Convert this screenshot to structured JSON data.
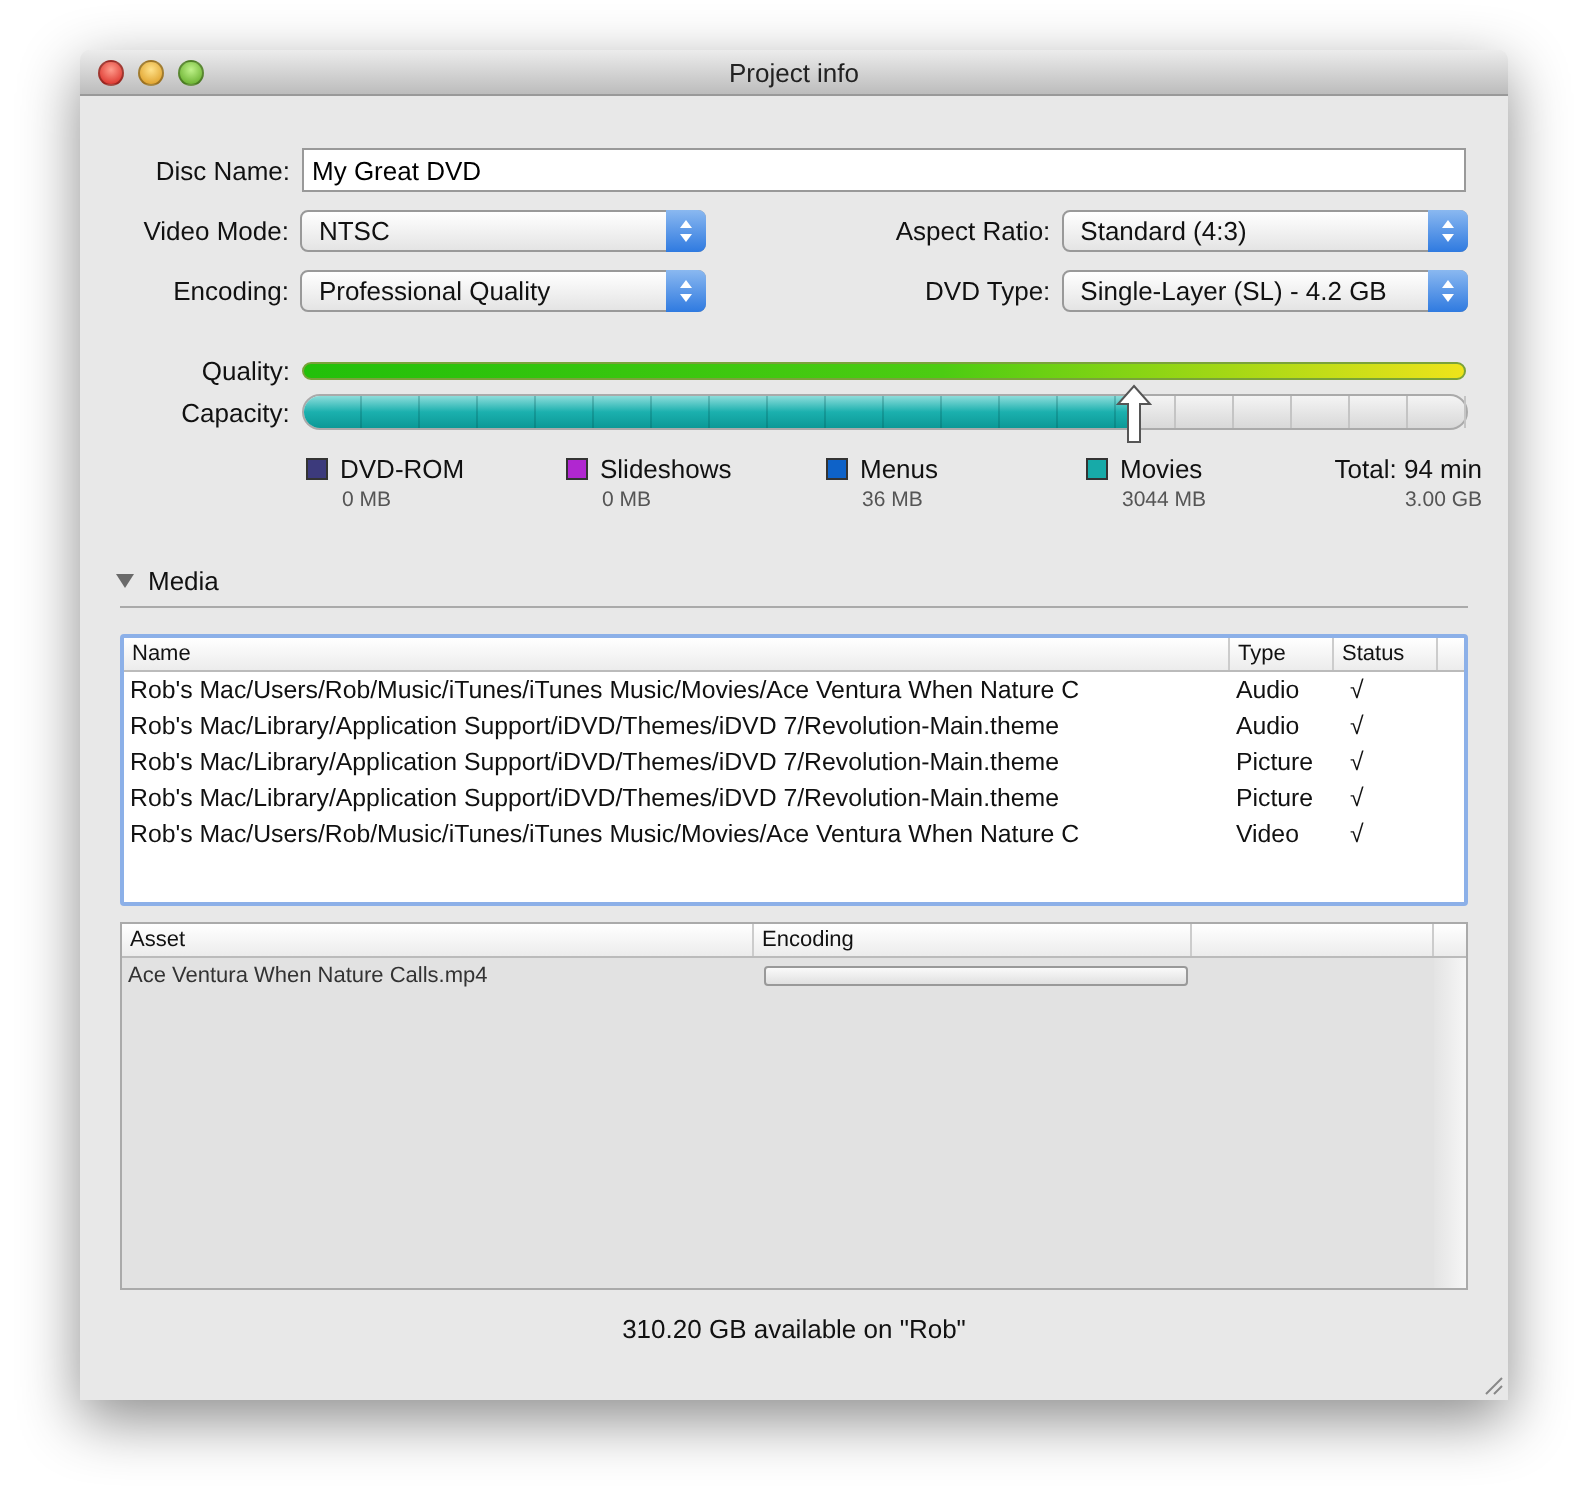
{
  "window": {
    "title": "Project info"
  },
  "form": {
    "disc_name": {
      "label": "Disc Name:",
      "value": "My Great DVD"
    },
    "video_mode": {
      "label": "Video Mode:",
      "value": "NTSC"
    },
    "aspect_ratio": {
      "label": "Aspect Ratio:",
      "value": "Standard (4:3)"
    },
    "encoding": {
      "label": "Encoding:",
      "value": "Professional Quality"
    },
    "dvd_type": {
      "label": "DVD Type:",
      "value": "Single-Layer (SL) - 4.2 GB"
    }
  },
  "quality": {
    "label": "Quality:"
  },
  "capacity": {
    "label": "Capacity:",
    "level": 0.715
  },
  "legend": [
    {
      "name": "DVD-ROM",
      "size": "0 MB",
      "color": "#3c3a7c"
    },
    {
      "name": "Slideshows",
      "size": "0 MB",
      "color": "#b027d0"
    },
    {
      "name": "Menus",
      "size": "36 MB",
      "color": "#0e62c8"
    },
    {
      "name": "Movies",
      "size": "3044 MB",
      "color": "#17aaa8"
    }
  ],
  "total": {
    "label": "Total: 94 min",
    "size": "3.00 GB"
  },
  "media": {
    "label": "Media",
    "expanded": true
  },
  "media_table": {
    "columns": [
      "Name",
      "Type",
      "Status"
    ],
    "rows": [
      {
        "name": "Rob's Mac/Users/Rob/Music/iTunes/iTunes Music/Movies/Ace Ventura When Nature C",
        "type": "Audio",
        "status": "√"
      },
      {
        "name": "Rob's Mac/Library/Application Support/iDVD/Themes/iDVD 7/Revolution-Main.theme",
        "type": "Audio",
        "status": "√"
      },
      {
        "name": "Rob's Mac/Library/Application Support/iDVD/Themes/iDVD 7/Revolution-Main.theme",
        "type": "Picture",
        "status": "√"
      },
      {
        "name": "Rob's Mac/Library/Application Support/iDVD/Themes/iDVD 7/Revolution-Main.theme",
        "type": "Picture",
        "status": "√"
      },
      {
        "name": "Rob's Mac/Users/Rob/Music/iTunes/iTunes Music/Movies/Ace Ventura When Nature C",
        "type": "Video",
        "status": "√"
      }
    ]
  },
  "asset_table": {
    "columns": [
      "Asset",
      "Encoding"
    ],
    "rows": [
      {
        "asset": "Ace Ventura When Nature Calls.mp4",
        "level": 0
      }
    ]
  },
  "status_bar": "310.20 GB available on \"Rob\""
}
